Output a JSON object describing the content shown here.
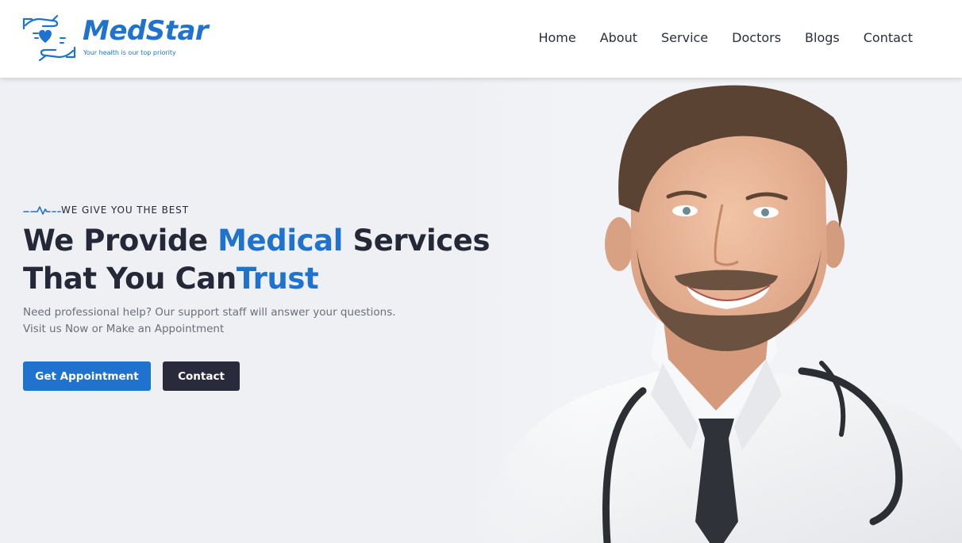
{
  "brand": {
    "name": "MedStar",
    "tagline": "Your health is our top priority",
    "color": "#1f73cf"
  },
  "nav": {
    "items": [
      {
        "label": "Home"
      },
      {
        "label": "About"
      },
      {
        "label": "Service"
      },
      {
        "label": "Doctors"
      },
      {
        "label": "Blogs"
      },
      {
        "label": "Contact"
      }
    ]
  },
  "hero": {
    "eyebrow": "WE GIVE YOU THE BEST",
    "eyebrow_icon": "heartbeat-line-icon",
    "title_line1_part1": "We Provide ",
    "title_line1_accent": "Medical",
    "title_line1_part2": " Services",
    "title_line2_part1": "That You Can",
    "title_line2_accent": "Trust",
    "description_line1": "Need professional help? Our support staff will answer your questions.",
    "description_line2": "Visit us Now or Make an Appointment",
    "primary_button": "Get Appointment",
    "secondary_button": "Contact",
    "photo": "smiling-doctor-with-stethoscope"
  },
  "colors": {
    "accent": "#1f73cf",
    "dark": "#252836",
    "dark_button": "#2a2a3d",
    "hero_background": "#eef0f4"
  }
}
